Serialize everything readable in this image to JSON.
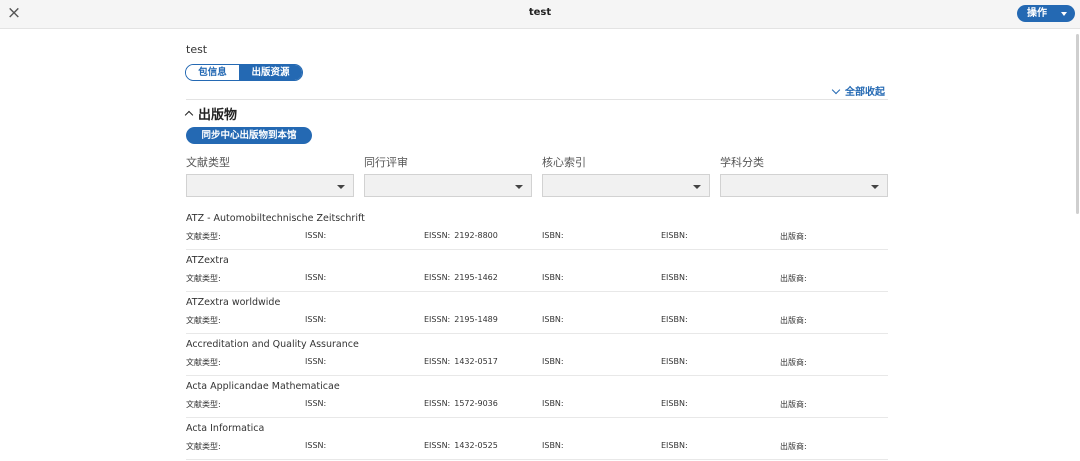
{
  "header": {
    "title": "test",
    "close_icon": "×",
    "ops_label": "操作"
  },
  "package": {
    "name": "test"
  },
  "tabs": [
    {
      "label": "包信息",
      "active": false
    },
    {
      "label": "出版资源",
      "active": true
    }
  ],
  "collapse_all_label": "全部收起",
  "section": {
    "title": "出版物",
    "sync_label": "同步中心出版物到本馆"
  },
  "filters": [
    {
      "label": "文献类型",
      "value": ""
    },
    {
      "label": "同行评审",
      "value": ""
    },
    {
      "label": "核心索引",
      "value": ""
    },
    {
      "label": "学科分类",
      "value": ""
    }
  ],
  "field_labels": {
    "doc_type": "文献类型:",
    "issn": "ISSN:",
    "eissn": "EISSN:",
    "isbn": "ISBN:",
    "eisbn": "EISBN:",
    "publisher": "出版商:"
  },
  "publications": [
    {
      "title": "ATZ - Automobiltechnische Zeitschrift",
      "doc_type": "",
      "issn": "",
      "eissn": "2192-8800",
      "isbn": "",
      "eisbn": "",
      "publisher": ""
    },
    {
      "title": "ATZextra",
      "doc_type": "",
      "issn": "",
      "eissn": "2195-1462",
      "isbn": "",
      "eisbn": "",
      "publisher": ""
    },
    {
      "title": "ATZextra worldwide",
      "doc_type": "",
      "issn": "",
      "eissn": "2195-1489",
      "isbn": "",
      "eisbn": "",
      "publisher": ""
    },
    {
      "title": "Accreditation and Quality Assurance",
      "doc_type": "",
      "issn": "",
      "eissn": "1432-0517",
      "isbn": "",
      "eisbn": "",
      "publisher": ""
    },
    {
      "title": "Acta Applicandae Mathematicae",
      "doc_type": "",
      "issn": "",
      "eissn": "1572-9036",
      "isbn": "",
      "eisbn": "",
      "publisher": ""
    },
    {
      "title": "Acta Informatica",
      "doc_type": "",
      "issn": "",
      "eissn": "1432-0525",
      "isbn": "",
      "eisbn": "",
      "publisher": ""
    }
  ],
  "colors": {
    "accent": "#2469b3",
    "topbar_bg": "#f5f5f5",
    "select_bg": "#f1f1f1"
  }
}
